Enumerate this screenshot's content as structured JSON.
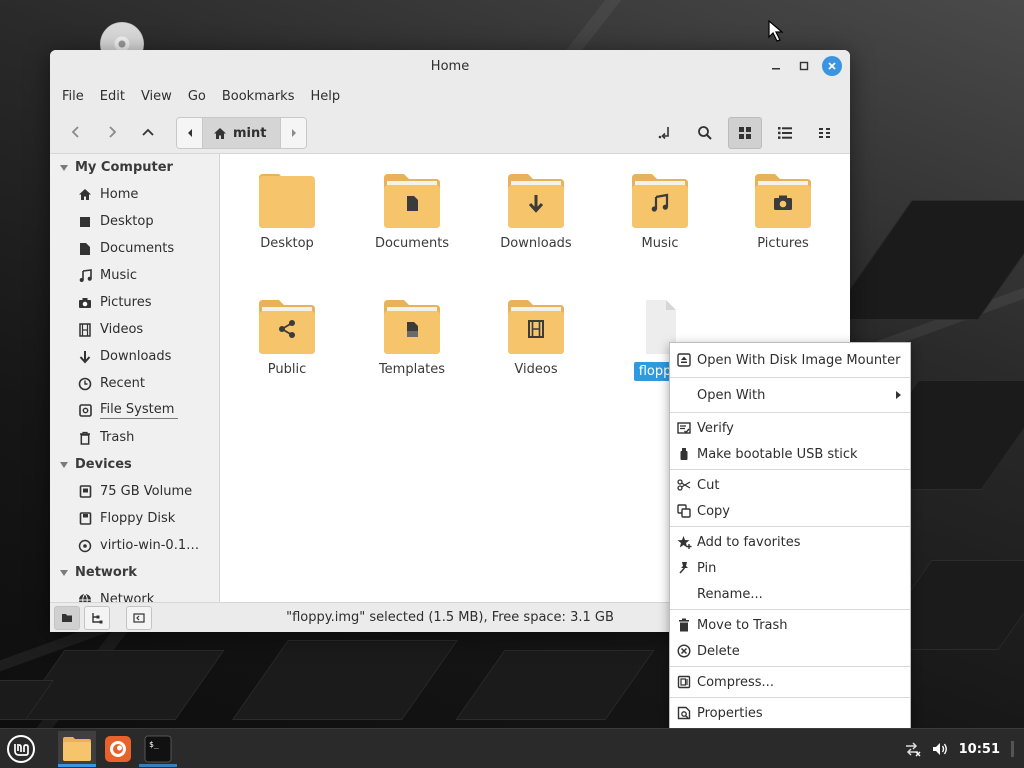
{
  "window": {
    "title": "Home",
    "menu": [
      "File",
      "Edit",
      "View",
      "Go",
      "Bookmarks",
      "Help"
    ]
  },
  "pathbar": {
    "current": "mint"
  },
  "sidebar": {
    "sections": [
      {
        "label": "My Computer",
        "items": [
          {
            "label": "Home",
            "icon": "home-icon"
          },
          {
            "label": "Desktop",
            "icon": "desktop-icon"
          },
          {
            "label": "Documents",
            "icon": "document-icon"
          },
          {
            "label": "Music",
            "icon": "music-icon"
          },
          {
            "label": "Pictures",
            "icon": "camera-icon"
          },
          {
            "label": "Videos",
            "icon": "film-icon"
          },
          {
            "label": "Downloads",
            "icon": "download-icon"
          },
          {
            "label": "Recent",
            "icon": "clock-icon"
          },
          {
            "label": "File System",
            "icon": "drive-icon"
          },
          {
            "label": "Trash",
            "icon": "trash-icon"
          }
        ]
      },
      {
        "label": "Devices",
        "items": [
          {
            "label": "75 GB Volume",
            "icon": "drive-icon"
          },
          {
            "label": "Floppy Disk",
            "icon": "floppy-icon"
          },
          {
            "label": "virtio-win-0.1…",
            "icon": "disc-icon"
          }
        ]
      },
      {
        "label": "Network",
        "items": [
          {
            "label": "Network",
            "icon": "network-icon"
          }
        ]
      }
    ]
  },
  "files": [
    {
      "label": "Desktop",
      "icon": "folder-icon"
    },
    {
      "label": "Documents",
      "icon": "folder-documents-icon"
    },
    {
      "label": "Downloads",
      "icon": "folder-download-icon"
    },
    {
      "label": "Music",
      "icon": "folder-music-icon"
    },
    {
      "label": "Pictures",
      "icon": "folder-pictures-icon"
    },
    {
      "label": "Public",
      "icon": "folder-share-icon"
    },
    {
      "label": "Templates",
      "icon": "folder-templates-icon"
    },
    {
      "label": "Videos",
      "icon": "folder-videos-icon"
    },
    {
      "label": "floppy.img",
      "visible_label": "floppy.",
      "icon": "file-icon",
      "selected": true
    }
  ],
  "status": {
    "text": "\"floppy.img\" selected (1.5 MB), Free space: 3.1 GB"
  },
  "context_menu": {
    "items": [
      {
        "label": "Open With Disk Image Mounter",
        "icon": "disk-mounter-icon"
      },
      {
        "label": "Open With",
        "icon": "",
        "submenu": true
      },
      {
        "label": "Verify",
        "icon": "verify-icon"
      },
      {
        "label": "Make bootable USB stick",
        "icon": "usb-icon"
      },
      {
        "label": "Cut",
        "icon": "scissors-icon"
      },
      {
        "label": "Copy",
        "icon": "copy-icon"
      },
      {
        "label": "Add to favorites",
        "icon": "star-plus-icon"
      },
      {
        "label": "Pin",
        "icon": "pin-icon"
      },
      {
        "label": "Rename...",
        "icon": ""
      },
      {
        "label": "Move to Trash",
        "icon": "trash-icon"
      },
      {
        "label": "Delete",
        "icon": "delete-icon"
      },
      {
        "label": "Compress...",
        "icon": "archive-icon"
      },
      {
        "label": "Properties",
        "icon": "properties-icon"
      }
    ]
  },
  "taskbar": {
    "clock": "10:51"
  },
  "colors": {
    "folder": "#f5c46b",
    "folder_tab": "#e8b25a",
    "accent": "#3a95e0",
    "selection": "#2e9ae0"
  }
}
